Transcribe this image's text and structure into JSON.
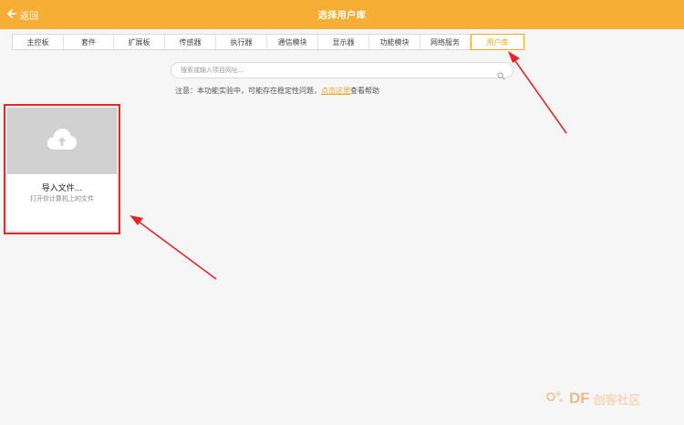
{
  "header": {
    "back_label": "返回",
    "title": "选择用户库",
    "background": "#f7ae34"
  },
  "tabs": [
    {
      "label": "主控板",
      "active": false
    },
    {
      "label": "套件",
      "active": false
    },
    {
      "label": "扩展板",
      "active": false
    },
    {
      "label": "传感器",
      "active": false
    },
    {
      "label": "执行器",
      "active": false
    },
    {
      "label": "通信模块",
      "active": false
    },
    {
      "label": "显示器",
      "active": false
    },
    {
      "label": "功能模块",
      "active": false
    },
    {
      "label": "网络服务",
      "active": false
    },
    {
      "label": "用户库",
      "active": true
    }
  ],
  "search": {
    "placeholder": "搜索或输入项目网址..."
  },
  "notice": {
    "prefix": "注意：本功能实验中，可能存在稳定性问题，",
    "link": "点击这里",
    "suffix": "查看帮助"
  },
  "import_card": {
    "title": "导入文件...",
    "subtitle": "打开你计算机上的文件"
  },
  "watermark": {
    "brand": "DF",
    "text": "创客社区"
  },
  "colors": {
    "accent": "#f5a623",
    "highlight": "#e8262a"
  }
}
